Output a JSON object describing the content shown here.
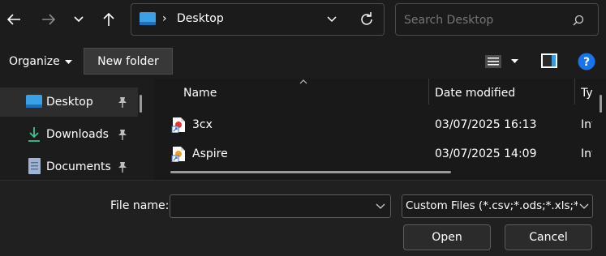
{
  "address": {
    "path": "Desktop"
  },
  "search": {
    "placeholder": "Search Desktop"
  },
  "toolbar": {
    "organize_label": "Organize",
    "new_folder_label": "New folder"
  },
  "sidebar": {
    "items": [
      {
        "label": "Desktop",
        "icon": "desktop-icon",
        "pinned": true,
        "selected": true
      },
      {
        "label": "Downloads",
        "icon": "download-icon",
        "pinned": true
      },
      {
        "label": "Documents",
        "icon": "document-icon",
        "pinned": true
      }
    ]
  },
  "columns": {
    "name": "Name",
    "date": "Date modified",
    "type": "Ty"
  },
  "files": [
    {
      "name": "3cx",
      "date": "03/07/2025 16:13",
      "type": "Int"
    },
    {
      "name": "Aspire",
      "date": "03/07/2025 14:09",
      "type": "Int"
    }
  ],
  "footer": {
    "file_name_label": "File name:",
    "file_name_value": "",
    "file_type": "Custom Files (*.csv;*.ods;*.xls;*.xl",
    "open_label": "Open",
    "cancel_label": "Cancel"
  },
  "colors": {
    "accent": "#0078d4",
    "help": "#1a73e8",
    "background": "#1c1c1c"
  }
}
